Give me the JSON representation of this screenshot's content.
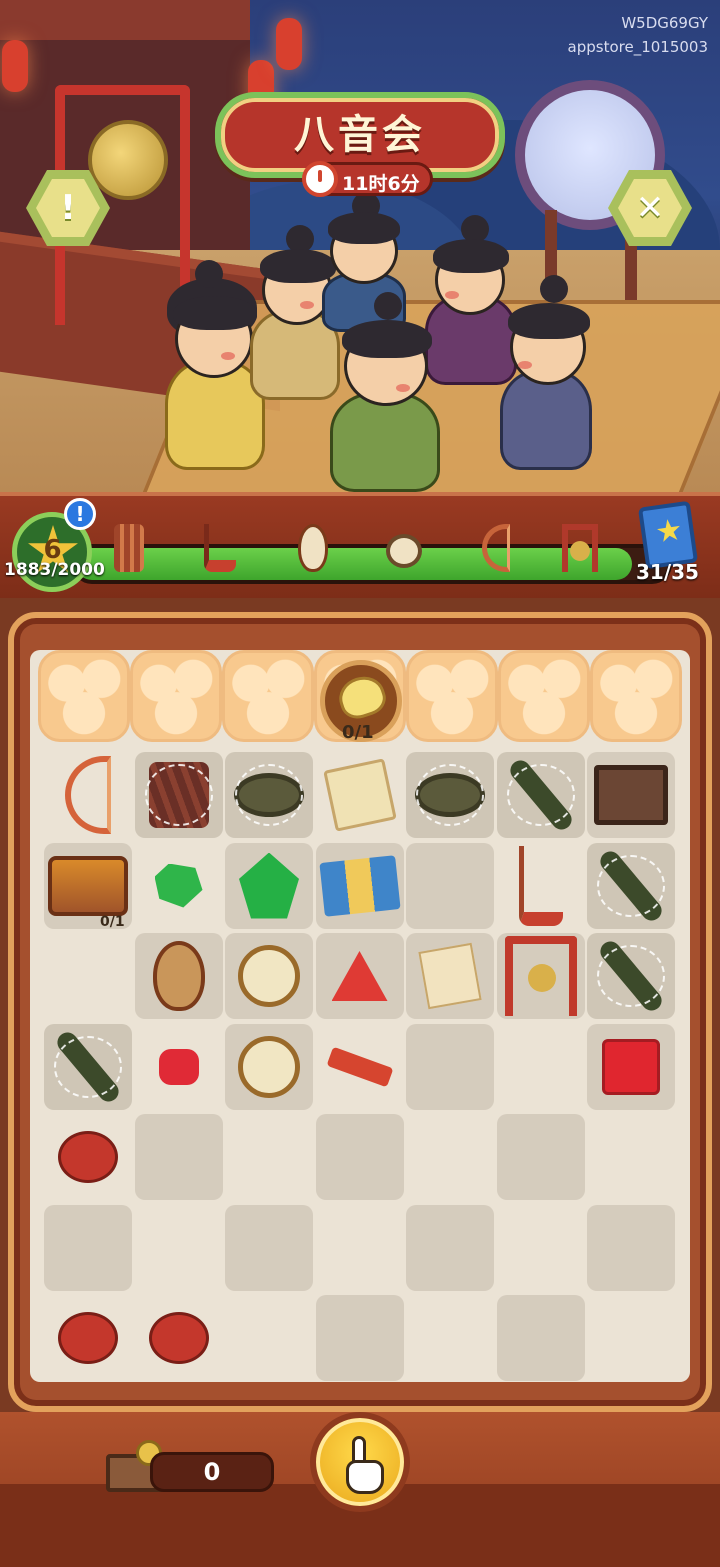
{
  "watermark": {
    "line1": "W5DG69GY",
    "line2": "appstore_1015003"
  },
  "event": {
    "title": "八音会",
    "timer": "11时6分"
  },
  "buttons": {
    "info_icon": "!",
    "close_icon": "✕"
  },
  "progress": {
    "level": "6",
    "xp_text": "1883/2000",
    "xp_fraction": 0.94,
    "alert_icon": "!",
    "milestone_icons": [
      "sheng-icon",
      "erhu-icon",
      "pipa-icon",
      "drum-icon",
      "harp-icon",
      "gong-icon"
    ],
    "book_count": "31/35",
    "colors": {
      "fill": "#4cbb36",
      "track": "#3c1c12"
    }
  },
  "board": {
    "target": {
      "icon": "fan-icon",
      "count": "0/1"
    },
    "jewelbox_count": "0/1",
    "columns": 7,
    "rows": 7,
    "items": [
      {
        "icon": "harp-icon",
        "row": 0,
        "col": 0,
        "webbed": false
      },
      {
        "icon": "reed-bundle-icon",
        "row": 0,
        "col": 1,
        "webbed": true
      },
      {
        "icon": "drum-icon",
        "row": 0,
        "col": 2,
        "webbed": true
      },
      {
        "icon": "scroll-icon",
        "row": 0,
        "col": 3,
        "webbed": false
      },
      {
        "icon": "drum-icon",
        "row": 0,
        "col": 4,
        "webbed": true
      },
      {
        "icon": "flute-icon",
        "row": 0,
        "col": 5,
        "webbed": true
      },
      {
        "icon": "crate-icon",
        "row": 0,
        "col": 6,
        "webbed": false
      },
      {
        "icon": "jewelbox-icon",
        "row": 1,
        "col": 0,
        "webbed": false
      },
      {
        "icon": "green-gem-small-icon",
        "row": 1,
        "col": 1,
        "webbed": false
      },
      {
        "icon": "green-gem-large-icon",
        "row": 1,
        "col": 2,
        "webbed": false
      },
      {
        "icon": "cards-icon",
        "row": 1,
        "col": 3,
        "webbed": false
      },
      {
        "icon": "erhu-icon",
        "row": 1,
        "col": 5,
        "webbed": false
      },
      {
        "icon": "flute-icon",
        "row": 1,
        "col": 6,
        "webbed": true
      },
      {
        "icon": "pipa-icon",
        "row": 2,
        "col": 1,
        "webbed": false
      },
      {
        "icon": "round-fan-icon",
        "row": 2,
        "col": 2,
        "webbed": false
      },
      {
        "icon": "red-gem-triangle-icon",
        "row": 2,
        "col": 3,
        "webbed": false
      },
      {
        "icon": "paper-icon",
        "row": 2,
        "col": 4,
        "webbed": false
      },
      {
        "icon": "gong-icon",
        "row": 2,
        "col": 5,
        "webbed": false
      },
      {
        "icon": "flute-icon",
        "row": 2,
        "col": 6,
        "webbed": true
      },
      {
        "icon": "flute-icon",
        "row": 3,
        "col": 0,
        "webbed": true
      },
      {
        "icon": "red-gem-small-icon",
        "row": 3,
        "col": 1,
        "webbed": false
      },
      {
        "icon": "round-fan-icon",
        "row": 3,
        "col": 2,
        "webbed": false
      },
      {
        "icon": "plank-icon",
        "row": 3,
        "col": 3,
        "webbed": false
      },
      {
        "icon": "red-gem-square-icon",
        "row": 3,
        "col": 6,
        "webbed": false
      },
      {
        "icon": "ocarina-icon",
        "row": 4,
        "col": 0,
        "webbed": false
      },
      {
        "icon": "ocarina-icon",
        "row": 6,
        "col": 0,
        "webbed": false
      },
      {
        "icon": "ocarina-icon",
        "row": 6,
        "col": 1,
        "webbed": false
      }
    ]
  },
  "bottom": {
    "storage_count": "0",
    "storage_icon": "gramophone-box-icon",
    "tap_icon": "tap-hand-icon"
  }
}
